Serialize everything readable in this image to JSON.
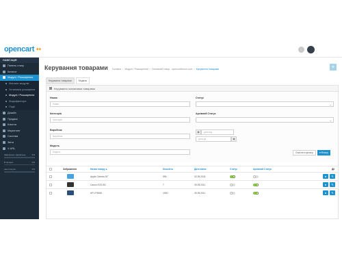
{
  "header": {
    "logo_text": "opencart",
    "logo_suffix": " ▪▪"
  },
  "sidebar": {
    "title": "НАВІГАЦІЯ",
    "items": [
      {
        "label": "Панель стану",
        "type": "item",
        "icon": "dashboard-icon"
      },
      {
        "label": "Каталог",
        "type": "item",
        "icon": "tag-icon"
      },
      {
        "label": "Модулі / Розширення",
        "type": "active",
        "icon": "puzzle-icon"
      },
      {
        "label": "Магазин модулів",
        "type": "sub"
      },
      {
        "label": "Установка розширень",
        "type": "sub"
      },
      {
        "label": "Модулі / Розширення",
        "type": "sub current"
      },
      {
        "label": "Модифікатори",
        "type": "sub"
      },
      {
        "label": "Події",
        "type": "sub"
      },
      {
        "label": "Дизайн",
        "type": "item",
        "icon": "monitor-icon"
      },
      {
        "label": "Продажі",
        "type": "item",
        "icon": "cart-icon"
      },
      {
        "label": "Клієнти",
        "type": "item",
        "icon": "user-icon"
      },
      {
        "label": "Маркетинг",
        "type": "item",
        "icon": "share-icon"
      },
      {
        "label": "Система",
        "type": "item",
        "icon": "gear-icon"
      },
      {
        "label": "Звіти",
        "type": "item",
        "icon": "chart-icon"
      },
      {
        "label": "V-URL",
        "type": "item",
        "icon": "link-icon"
      }
    ],
    "progress": [
      {
        "label": "Завершено замовлень",
        "value": "0%",
        "fraction": 0.0,
        "color": "#8ac24a"
      },
      {
        "label": "В процесі",
        "value": "0%",
        "fraction": 0.0,
        "color": "#f3a638"
      },
      {
        "label": "Інші статуси",
        "value": "0%",
        "fraction": 0.0,
        "color": "#1e91cf"
      }
    ]
  },
  "main": {
    "title": "Керування товарами",
    "breadcrumb": [
      "Головна",
      "Модулі / Розширення",
      "Основний товар - opencartforum.com",
      "Керування товарами"
    ],
    "tabs": [
      "Керування товарами",
      "Модель"
    ],
    "panel_title": "Керування основними товарами",
    "filter": {
      "name_label": "Назва",
      "name_placeholder": "Назва",
      "category_label": "Категорія",
      "category_placeholder": "Категорія",
      "manufacturer_label": "Виробник",
      "manufacturer_placeholder": "Виробник",
      "model_label": "Модель",
      "model_placeholder": "Модель",
      "status_label": "Статус",
      "archive_status_label": "Архівний Статус",
      "date_from_placeholder": "дата від",
      "date_to_placeholder": "дата до",
      "clear_label": "Очистити фільтр",
      "filter_label": "Фільтр"
    },
    "table": {
      "headers": [
        "Зображення",
        "Назва товару",
        "Кількість",
        "Дата зміни",
        "Статус",
        "Архівний Статус",
        "Дії"
      ],
      "rows": [
        {
          "name": "Apple Cinema 30\"",
          "qty": "990",
          "date": "02.05.2024",
          "status": true,
          "archive": false,
          "thumb": "#4aa3df"
        },
        {
          "name": "Canon EOS 5D",
          "qty": "7",
          "date": "30.05.2011",
          "status": false,
          "archive": true,
          "thumb": "#333333"
        },
        {
          "name": "HP LP3065",
          "qty": "1000",
          "date": "30.05.2011",
          "status": false,
          "archive": true,
          "thumb": "#2a4f7a"
        }
      ]
    }
  }
}
